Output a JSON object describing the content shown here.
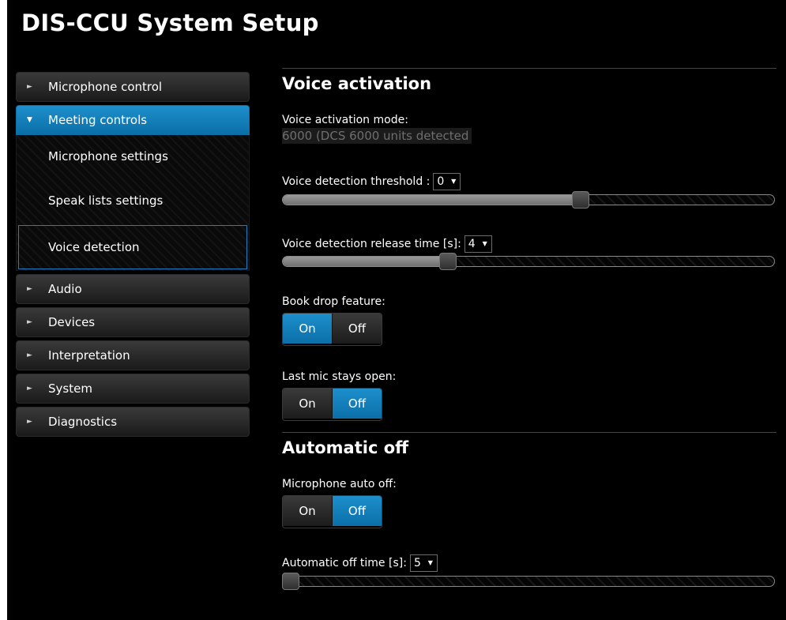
{
  "app": {
    "title": "DIS-CCU System Setup"
  },
  "colors": {
    "accent": "#1d8fcc",
    "background": "#000000",
    "muted_text": "#6e6e6e"
  },
  "sidebar": {
    "items": [
      {
        "label": "Microphone control",
        "expanded": false
      },
      {
        "label": "Meeting controls",
        "expanded": true,
        "active": true
      },
      {
        "label": "Audio",
        "expanded": false
      },
      {
        "label": "Devices",
        "expanded": false
      },
      {
        "label": "Interpretation",
        "expanded": false
      },
      {
        "label": "System",
        "expanded": false
      },
      {
        "label": "Diagnostics",
        "expanded": false
      }
    ],
    "submenu": [
      {
        "label": "Microphone settings"
      },
      {
        "label": "Speak lists settings"
      },
      {
        "label": "Voice detection",
        "selected": true
      }
    ]
  },
  "main": {
    "voice_activation": {
      "title": "Voice activation",
      "mode_label": "Voice activation mode:",
      "mode_value": "6000 (DCS 6000 units detected",
      "threshold_label": "Voice detection threshold :",
      "threshold_value": "0",
      "threshold_level_fraction": 0.6,
      "release_label": "Voice detection release time [s]:",
      "release_value": "4",
      "release_level_fraction": 0.33,
      "book_drop_label": "Book drop feature:",
      "book_drop": {
        "on": "On",
        "off": "Off",
        "selected": "On"
      },
      "last_mic_label": "Last mic stays open:",
      "last_mic": {
        "on": "On",
        "off": "Off",
        "selected": "Off"
      }
    },
    "automatic_off": {
      "title": "Automatic off",
      "auto_off_label": "Microphone auto off:",
      "auto_off": {
        "on": "On",
        "off": "Off",
        "selected": "Off"
      },
      "time_label": "Automatic off time [s]:",
      "time_value": "5",
      "time_level_fraction": 0.0
    }
  },
  "icons": {
    "collapsed": "caret-right-icon",
    "expanded": "caret-down-icon",
    "select": "dropdown-caret-icon"
  }
}
